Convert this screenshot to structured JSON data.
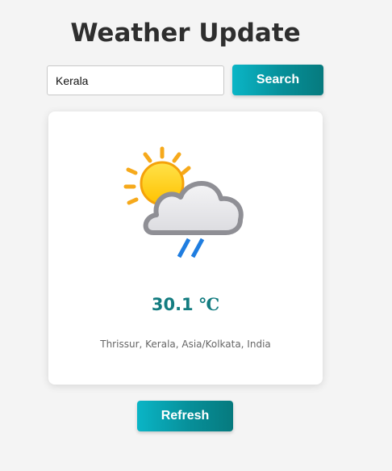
{
  "header": {
    "title": "Weather Update"
  },
  "search": {
    "value": "Kerala",
    "button_label": "Search"
  },
  "weather": {
    "temperature_value": "30.1",
    "temperature_unit": "℃",
    "location": "Thrissur, Kerala, Asia/Kolkata, India",
    "icon": "partly-cloudy-rain-icon"
  },
  "actions": {
    "refresh_label": "Refresh"
  },
  "colors": {
    "accent": "#0ab5c6",
    "accent_dark": "#067a7e",
    "temperature": "#137c80",
    "background": "#f4f4f4"
  }
}
